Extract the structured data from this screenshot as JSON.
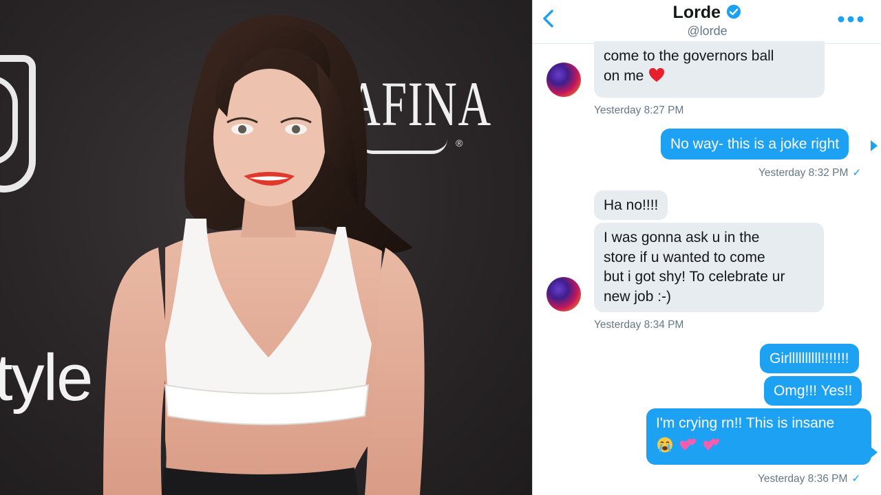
{
  "photo": {
    "logo_text": "AFINA",
    "logo_reg": "®",
    "style_text": "tyle"
  },
  "header": {
    "name": "Lorde",
    "handle": "@lorde"
  },
  "messages": [
    {
      "id": "m1",
      "dir": "in",
      "lines": [
        "come to the governors ball",
        "on me"
      ],
      "emoji": "red-heart"
    },
    {
      "id": "t1",
      "text": "Yesterday 8:27 PM"
    },
    {
      "id": "m2",
      "dir": "out",
      "text": "No way- this is a joke right"
    },
    {
      "id": "t2",
      "text": "Yesterday 8:32 PM",
      "read_mark": "✓"
    },
    {
      "id": "m3",
      "dir": "in",
      "text": "Ha no!!!!"
    },
    {
      "id": "m4",
      "dir": "in",
      "lines": [
        "I was gonna ask u in the",
        "store if u wanted to come",
        "but i got shy! To celebrate ur",
        "new job :-)"
      ]
    },
    {
      "id": "t3",
      "text": "Yesterday 8:34 PM"
    },
    {
      "id": "m5",
      "dir": "out",
      "text": "Girllllllllll!!!!!!!"
    },
    {
      "id": "m6",
      "dir": "out",
      "text": "Omg!!! Yes!!"
    },
    {
      "id": "m7",
      "dir": "out",
      "text": "I'm crying rn!! This is insane",
      "emoji": [
        "crying-face",
        "two-hearts",
        "two-hearts"
      ]
    },
    {
      "id": "t4",
      "text": "Yesterday 8:36 PM",
      "read_mark": "✓"
    }
  ],
  "colors": {
    "outgoing": "#1da1f2",
    "incoming": "#e6ecf0",
    "accent": "#1da1f2"
  }
}
